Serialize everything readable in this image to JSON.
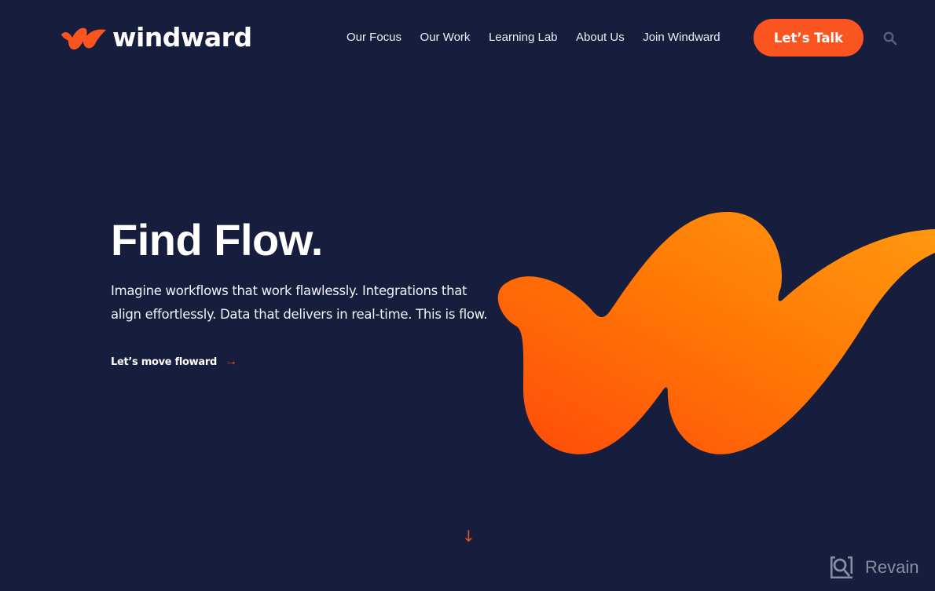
{
  "brand": {
    "name": "windward",
    "accent_color": "#fa5421",
    "background_color": "#161d3d"
  },
  "nav": {
    "items": [
      {
        "label": "Our Focus"
      },
      {
        "label": "Our Work"
      },
      {
        "label": "Learning Lab"
      },
      {
        "label": "About Us"
      },
      {
        "label": "Join Windward"
      }
    ],
    "cta_label": "Let’s Talk",
    "search_icon": "search-icon"
  },
  "hero": {
    "title": "Find Flow.",
    "description": "Imagine workflows that work flawlessly. Integrations that align effortlessly. Data that delivers in real-time. This is flow.",
    "link_label": "Let’s move floward",
    "link_arrow": "→",
    "scroll_arrow": "↓"
  },
  "watermark": {
    "label": "Revain"
  }
}
